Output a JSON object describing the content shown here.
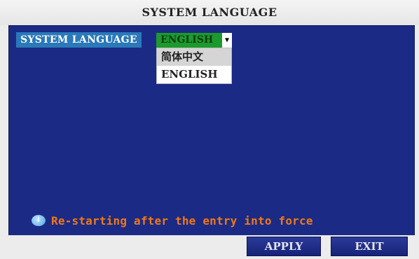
{
  "window": {
    "title": "SYSTEM LANGUAGE"
  },
  "settings": {
    "language_label": "SYSTEM LANGUAGE",
    "selected_language": "ENGLISH",
    "dropdown_arrow_icon": "chevron-down-icon"
  },
  "dropdown": {
    "options": [
      "简体中文",
      "ENGLISH"
    ]
  },
  "notice": {
    "icon": "info-icon",
    "text": "Re-starting after the entry into force"
  },
  "buttons": {
    "apply": "APPLY",
    "exit": "EXIT"
  },
  "colors": {
    "panel_bg": "#1b2a85",
    "label_bg": "#2a79b9",
    "selected_bg": "#1d9a2e",
    "notice_text": "#f07818"
  }
}
